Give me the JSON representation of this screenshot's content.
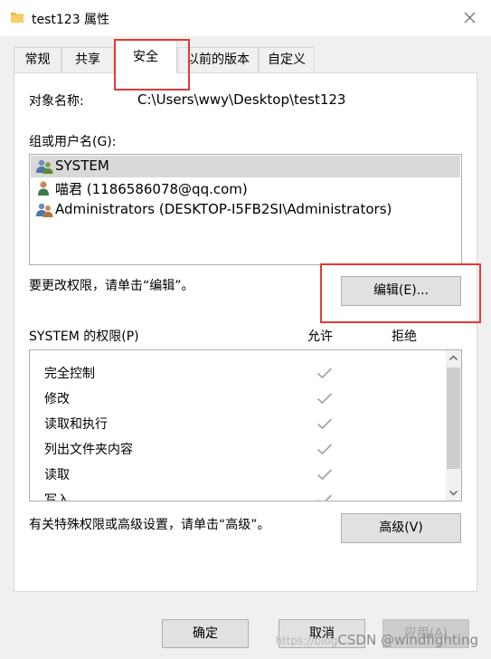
{
  "window": {
    "title": "test123 属性",
    "folder_icon": "folder-icon",
    "close_icon": "close-icon"
  },
  "tabs": [
    {
      "label": "常规"
    },
    {
      "label": "共享"
    },
    {
      "label": "安全",
      "active": true
    },
    {
      "label": "以前的版本"
    },
    {
      "label": "自定义"
    }
  ],
  "security": {
    "object_label": "对象名称:",
    "object_value": "C:\\Users\\wwy\\Desktop\\test123",
    "group_label": "组或用户名(G):",
    "users": [
      {
        "name": "SYSTEM",
        "icon": "user-group-icon",
        "selected": true
      },
      {
        "name": "喵君 (1186586078@qq.com)",
        "icon": "user-icon"
      },
      {
        "name": "Administrators (DESKTOP-I5FB2SI\\Administrators)",
        "icon": "user-group-icon"
      }
    ],
    "change_hint": "要更改权限，请单击“编辑”。",
    "edit_button": "编辑(E)...",
    "permissions_label": "SYSTEM 的权限(P)",
    "allow_header": "允许",
    "deny_header": "拒绝",
    "permissions": [
      {
        "name": "完全控制",
        "allow": true,
        "deny": false
      },
      {
        "name": "修改",
        "allow": true,
        "deny": false
      },
      {
        "name": "读取和执行",
        "allow": true,
        "deny": false
      },
      {
        "name": "列出文件夹内容",
        "allow": true,
        "deny": false
      },
      {
        "name": "读取",
        "allow": true,
        "deny": false
      },
      {
        "name": "写入",
        "allow": true,
        "deny": false
      }
    ],
    "advanced_hint": "有关特殊权限或高级设置，请单击“高级”。",
    "advanced_button": "高级(V)"
  },
  "footer": {
    "ok": "确定",
    "cancel": "取消",
    "apply": "应用(A)"
  },
  "watermark": {
    "prefix": "https://blog",
    "text": "CSDN @windfighting"
  },
  "colors": {
    "highlight_box": "#e53935",
    "selected_row": "#d9d9d9",
    "check_mark": "#a6a6a6"
  }
}
